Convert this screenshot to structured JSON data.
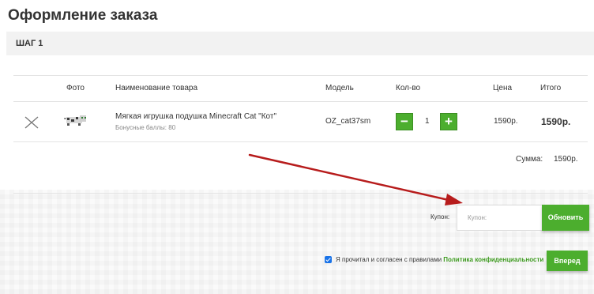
{
  "page": {
    "title": "Оформление заказа"
  },
  "step": {
    "label": "ШАГ 1"
  },
  "table": {
    "headers": {
      "photo": "Фото",
      "name": "Наименование товара",
      "model": "Модель",
      "qty": "Кол-во",
      "price": "Цена",
      "total": "Итого"
    },
    "rows": [
      {
        "name": "Мягкая игрушка подушка Minecraft Cat \"Кот\"",
        "bonus": "Бонусные баллы: 80",
        "model": "OZ_cat37sm",
        "qty": "1",
        "price": "1590р.",
        "total": "1590р."
      }
    ]
  },
  "summary": {
    "label": "Сумма:",
    "value": "1590р."
  },
  "coupon": {
    "label": "Купон:",
    "placeholder": "Купон:",
    "value": "",
    "apply_label": "Обновить"
  },
  "agreement": {
    "checked": true,
    "text": "Я прочитал и согласен с правилами",
    "link": "Политика конфиденциальности"
  },
  "next": {
    "label": "Вперед"
  },
  "colors": {
    "accent": "#4cae2e",
    "arrow": "#b71c1c",
    "link": "#3d9a1f"
  },
  "icons": {
    "remove": "close-icon",
    "qty_minus": "minus-icon",
    "qty_plus": "plus-icon"
  }
}
